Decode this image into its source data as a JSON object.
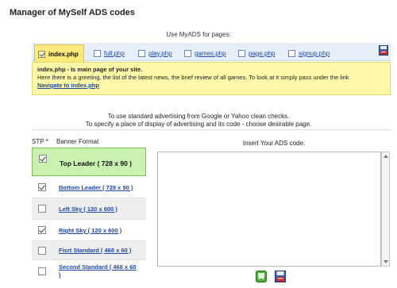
{
  "title": "Manager of MySelf ADS codes",
  "use_label": "Use MyADS for pages:",
  "tabs": [
    {
      "label": "index.php",
      "active": true
    },
    {
      "label": "full.php"
    },
    {
      "label": "play.php"
    },
    {
      "label": "games.php"
    },
    {
      "label": "page.php"
    },
    {
      "label": "signup.php"
    }
  ],
  "info": {
    "page_name": "index.php",
    "heading_rest": " - Is main page of your site.",
    "description": "Here there is a greeting, the list of the latest news, the brief review of all games. To look at it simply pass under the link",
    "link_text": "Navigate to index.php"
  },
  "note_line1": "To use standard advertising from Google or Yahoo clean checks.",
  "note_line2": "To specify a place of display of advertising and its code - choose desirable page.",
  "table": {
    "col_stp": "STP *",
    "col_format": "Banner Format",
    "rows": [
      {
        "label": "Top Leader ( 728 x 90 )",
        "checked": true
      },
      {
        "label": "Bottom Leader ( 728 x 90 )",
        "checked": true
      },
      {
        "label": "Left Sky ( 120 x 600 )",
        "checked": false
      },
      {
        "label": "Right Sky ( 120 x 600 )",
        "checked": true
      },
      {
        "label": "Fisrt Standard ( 468 x 60 )",
        "checked": false
      },
      {
        "label": "Second Standard ( 468 x 60 )",
        "checked": false
      }
    ]
  },
  "insert_label": "Insert Your ADS code:",
  "textarea_value": "",
  "icons": {
    "save": "floppy-disk-icon",
    "apply": "green-apply-icon"
  },
  "colors": {
    "active_tab": "#ffe97a",
    "info_bg": "#fff8a8",
    "selected_row": "#c9f2b0",
    "link": "#1f4aa8"
  }
}
